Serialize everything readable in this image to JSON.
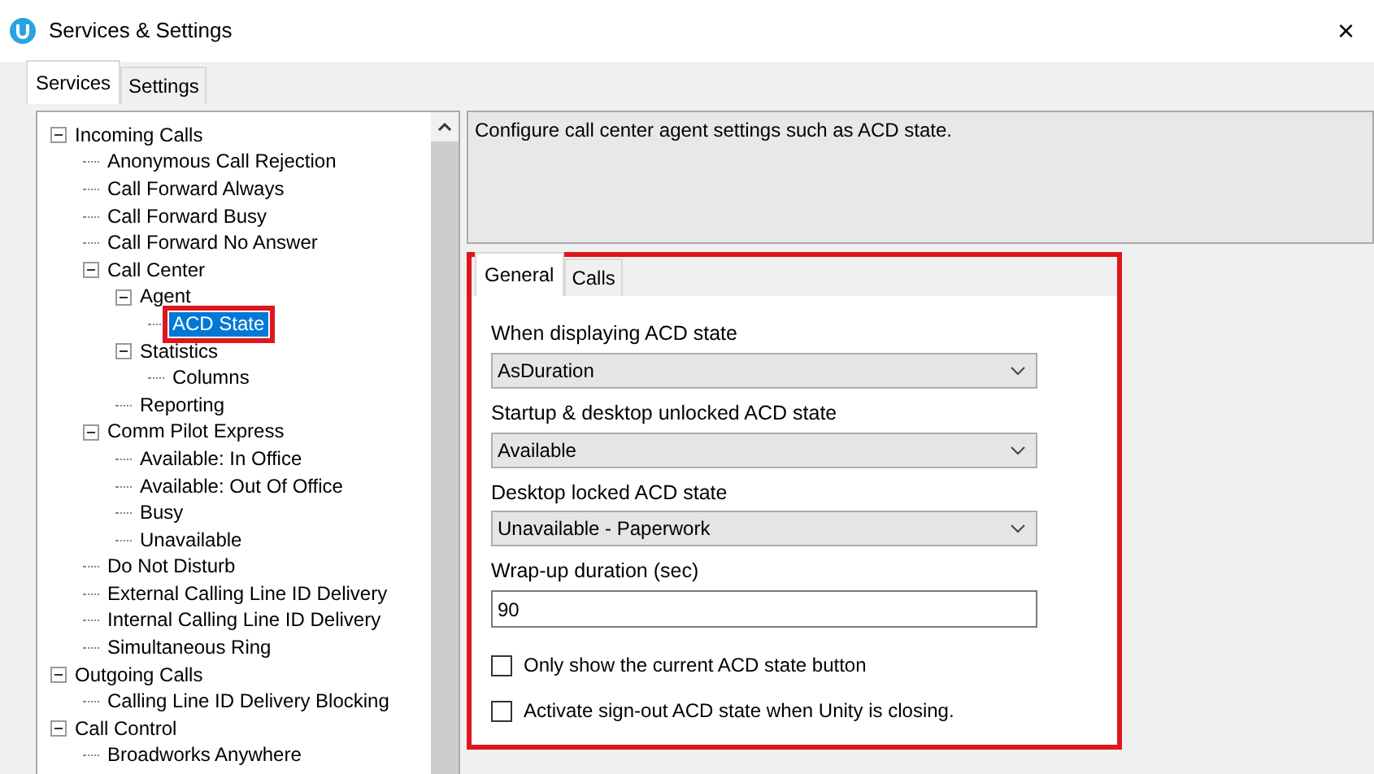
{
  "window": {
    "title": "Services & Settings",
    "close": "×"
  },
  "tabs": [
    {
      "label": "Services",
      "selected": true
    },
    {
      "label": "Settings",
      "selected": false
    }
  ],
  "tree": [
    {
      "label": "Incoming Calls",
      "expanded": true,
      "selected": false,
      "annotated": false,
      "children": [
        {
          "label": "Anonymous Call Rejection",
          "selected": false,
          "annotated": false
        },
        {
          "label": "Call Forward Always",
          "selected": false,
          "annotated": false
        },
        {
          "label": "Call Forward Busy",
          "selected": false,
          "annotated": false
        },
        {
          "label": "Call Forward No Answer",
          "selected": false,
          "annotated": false
        },
        {
          "label": "Call Center",
          "expanded": true,
          "selected": false,
          "annotated": false,
          "children": [
            {
              "label": "Agent",
              "expanded": true,
              "selected": false,
              "annotated": false,
              "children": [
                {
                  "label": "ACD State",
                  "selected": true,
                  "annotated": true
                }
              ]
            },
            {
              "label": "Statistics",
              "expanded": true,
              "selected": false,
              "annotated": false,
              "children": [
                {
                  "label": "Columns",
                  "selected": false,
                  "annotated": false
                }
              ]
            },
            {
              "label": "Reporting",
              "selected": false,
              "annotated": false
            }
          ]
        },
        {
          "label": "Comm Pilot Express",
          "expanded": true,
          "selected": false,
          "annotated": false,
          "children": [
            {
              "label": "Available: In Office",
              "selected": false,
              "annotated": false
            },
            {
              "label": "Available: Out Of Office",
              "selected": false,
              "annotated": false
            },
            {
              "label": "Busy",
              "selected": false,
              "annotated": false
            },
            {
              "label": "Unavailable",
              "selected": false,
              "annotated": false
            }
          ]
        },
        {
          "label": "Do Not Disturb",
          "selected": false,
          "annotated": false
        },
        {
          "label": "External Calling Line ID Delivery",
          "selected": false,
          "annotated": false
        },
        {
          "label": "Internal Calling Line ID Delivery",
          "selected": false,
          "annotated": false
        },
        {
          "label": "Simultaneous Ring",
          "selected": false,
          "annotated": false
        }
      ]
    },
    {
      "label": "Outgoing Calls",
      "expanded": true,
      "selected": false,
      "annotated": false,
      "children": [
        {
          "label": "Calling Line ID Delivery Blocking",
          "selected": false,
          "annotated": false
        }
      ]
    },
    {
      "label": "Call Control",
      "expanded": true,
      "selected": false,
      "annotated": false,
      "children": [
        {
          "label": "Broadworks Anywhere",
          "selected": false,
          "annotated": false
        }
      ]
    }
  ],
  "description": "Configure call center agent settings such as ACD state.",
  "panel": {
    "annotated": true,
    "tabs": [
      {
        "label": "General",
        "selected": true
      },
      {
        "label": "Calls",
        "selected": false
      }
    ],
    "fields": [
      {
        "kind": "select",
        "label": "When displaying ACD state",
        "value": "AsDuration"
      },
      {
        "kind": "select",
        "label": "Startup & desktop unlocked ACD state",
        "value": "Available"
      },
      {
        "kind": "select",
        "label": "Desktop locked ACD state",
        "value": "Unavailable - Paperwork"
      },
      {
        "kind": "text",
        "label": "Wrap-up duration (sec)",
        "value": "90"
      },
      {
        "kind": "checkbox",
        "label": "Only show the current ACD state button",
        "checked": false
      },
      {
        "kind": "checkbox",
        "label": "Activate sign-out ACD state when Unity is closing.",
        "checked": false
      }
    ]
  }
}
